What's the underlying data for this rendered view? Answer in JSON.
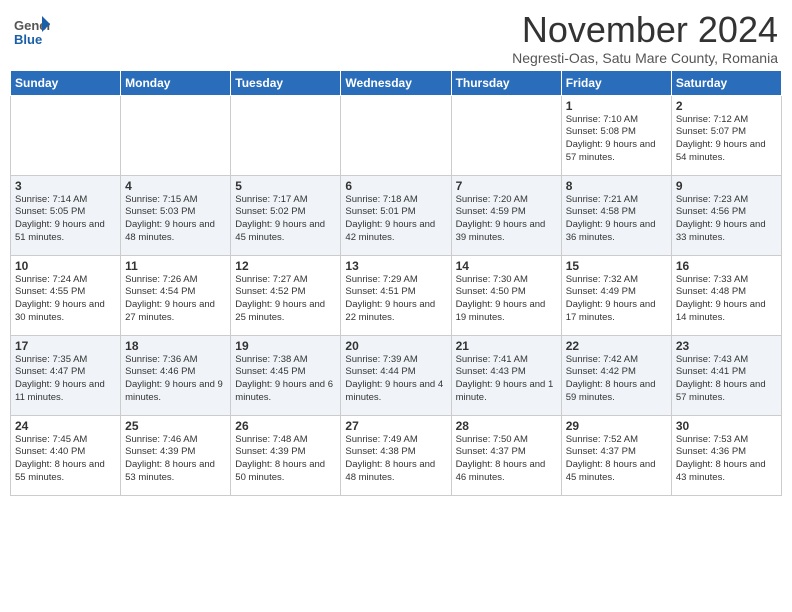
{
  "header": {
    "logo_general": "General",
    "logo_blue": "Blue",
    "month_title": "November 2024",
    "subtitle": "Negresti-Oas, Satu Mare County, Romania"
  },
  "days_of_week": [
    "Sunday",
    "Monday",
    "Tuesday",
    "Wednesday",
    "Thursday",
    "Friday",
    "Saturday"
  ],
  "weeks": [
    [
      {
        "day": "",
        "info": ""
      },
      {
        "day": "",
        "info": ""
      },
      {
        "day": "",
        "info": ""
      },
      {
        "day": "",
        "info": ""
      },
      {
        "day": "",
        "info": ""
      },
      {
        "day": "1",
        "info": "Sunrise: 7:10 AM\nSunset: 5:08 PM\nDaylight: 9 hours\nand 57 minutes."
      },
      {
        "day": "2",
        "info": "Sunrise: 7:12 AM\nSunset: 5:07 PM\nDaylight: 9 hours\nand 54 minutes."
      }
    ],
    [
      {
        "day": "3",
        "info": "Sunrise: 7:14 AM\nSunset: 5:05 PM\nDaylight: 9 hours\nand 51 minutes."
      },
      {
        "day": "4",
        "info": "Sunrise: 7:15 AM\nSunset: 5:03 PM\nDaylight: 9 hours\nand 48 minutes."
      },
      {
        "day": "5",
        "info": "Sunrise: 7:17 AM\nSunset: 5:02 PM\nDaylight: 9 hours\nand 45 minutes."
      },
      {
        "day": "6",
        "info": "Sunrise: 7:18 AM\nSunset: 5:01 PM\nDaylight: 9 hours\nand 42 minutes."
      },
      {
        "day": "7",
        "info": "Sunrise: 7:20 AM\nSunset: 4:59 PM\nDaylight: 9 hours\nand 39 minutes."
      },
      {
        "day": "8",
        "info": "Sunrise: 7:21 AM\nSunset: 4:58 PM\nDaylight: 9 hours\nand 36 minutes."
      },
      {
        "day": "9",
        "info": "Sunrise: 7:23 AM\nSunset: 4:56 PM\nDaylight: 9 hours\nand 33 minutes."
      }
    ],
    [
      {
        "day": "10",
        "info": "Sunrise: 7:24 AM\nSunset: 4:55 PM\nDaylight: 9 hours\nand 30 minutes."
      },
      {
        "day": "11",
        "info": "Sunrise: 7:26 AM\nSunset: 4:54 PM\nDaylight: 9 hours\nand 27 minutes."
      },
      {
        "day": "12",
        "info": "Sunrise: 7:27 AM\nSunset: 4:52 PM\nDaylight: 9 hours\nand 25 minutes."
      },
      {
        "day": "13",
        "info": "Sunrise: 7:29 AM\nSunset: 4:51 PM\nDaylight: 9 hours\nand 22 minutes."
      },
      {
        "day": "14",
        "info": "Sunrise: 7:30 AM\nSunset: 4:50 PM\nDaylight: 9 hours\nand 19 minutes."
      },
      {
        "day": "15",
        "info": "Sunrise: 7:32 AM\nSunset: 4:49 PM\nDaylight: 9 hours\nand 17 minutes."
      },
      {
        "day": "16",
        "info": "Sunrise: 7:33 AM\nSunset: 4:48 PM\nDaylight: 9 hours\nand 14 minutes."
      }
    ],
    [
      {
        "day": "17",
        "info": "Sunrise: 7:35 AM\nSunset: 4:47 PM\nDaylight: 9 hours\nand 11 minutes."
      },
      {
        "day": "18",
        "info": "Sunrise: 7:36 AM\nSunset: 4:46 PM\nDaylight: 9 hours\nand 9 minutes."
      },
      {
        "day": "19",
        "info": "Sunrise: 7:38 AM\nSunset: 4:45 PM\nDaylight: 9 hours\nand 6 minutes."
      },
      {
        "day": "20",
        "info": "Sunrise: 7:39 AM\nSunset: 4:44 PM\nDaylight: 9 hours\nand 4 minutes."
      },
      {
        "day": "21",
        "info": "Sunrise: 7:41 AM\nSunset: 4:43 PM\nDaylight: 9 hours\nand 1 minute."
      },
      {
        "day": "22",
        "info": "Sunrise: 7:42 AM\nSunset: 4:42 PM\nDaylight: 8 hours\nand 59 minutes."
      },
      {
        "day": "23",
        "info": "Sunrise: 7:43 AM\nSunset: 4:41 PM\nDaylight: 8 hours\nand 57 minutes."
      }
    ],
    [
      {
        "day": "24",
        "info": "Sunrise: 7:45 AM\nSunset: 4:40 PM\nDaylight: 8 hours\nand 55 minutes."
      },
      {
        "day": "25",
        "info": "Sunrise: 7:46 AM\nSunset: 4:39 PM\nDaylight: 8 hours\nand 53 minutes."
      },
      {
        "day": "26",
        "info": "Sunrise: 7:48 AM\nSunset: 4:39 PM\nDaylight: 8 hours\nand 50 minutes."
      },
      {
        "day": "27",
        "info": "Sunrise: 7:49 AM\nSunset: 4:38 PM\nDaylight: 8 hours\nand 48 minutes."
      },
      {
        "day": "28",
        "info": "Sunrise: 7:50 AM\nSunset: 4:37 PM\nDaylight: 8 hours\nand 46 minutes."
      },
      {
        "day": "29",
        "info": "Sunrise: 7:52 AM\nSunset: 4:37 PM\nDaylight: 8 hours\nand 45 minutes."
      },
      {
        "day": "30",
        "info": "Sunrise: 7:53 AM\nSunset: 4:36 PM\nDaylight: 8 hours\nand 43 minutes."
      }
    ]
  ]
}
